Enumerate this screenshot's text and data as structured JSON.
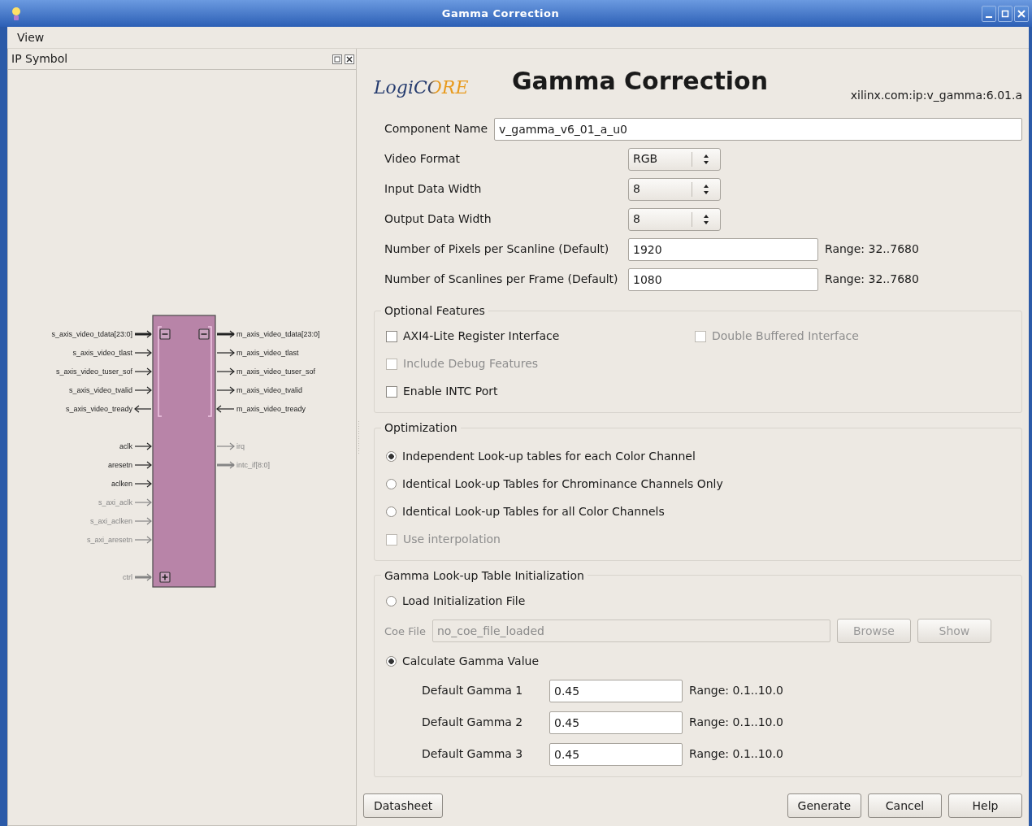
{
  "window": {
    "title": "Gamma Correction"
  },
  "menu": [
    {
      "label": "View"
    }
  ],
  "ip_panel": {
    "title": "IP Symbol",
    "symbol": {
      "left_groups": [
        [
          {
            "name": "s_axis_video_tdata[23:0]",
            "output": false,
            "bus": true,
            "disabled": false,
            "expanded": true
          },
          {
            "name": "s_axis_video_tlast",
            "output": false,
            "bus": false,
            "disabled": false
          },
          {
            "name": "s_axis_video_tuser_sof",
            "output": false,
            "bus": false,
            "disabled": false
          },
          {
            "name": "s_axis_video_tvalid",
            "output": false,
            "bus": false,
            "disabled": false
          },
          {
            "name": "s_axis_video_tready",
            "output": true,
            "bus": false,
            "disabled": false
          }
        ],
        [
          {
            "name": "aclk",
            "output": false,
            "bus": false,
            "disabled": false
          },
          {
            "name": "aresetn",
            "output": false,
            "bus": false,
            "disabled": false
          },
          {
            "name": "aclken",
            "output": false,
            "bus": false,
            "disabled": false
          },
          {
            "name": "s_axi_aclk",
            "output": false,
            "bus": false,
            "disabled": true
          },
          {
            "name": "s_axi_aclken",
            "output": false,
            "bus": false,
            "disabled": true
          },
          {
            "name": "s_axi_aresetn",
            "output": false,
            "bus": false,
            "disabled": true
          }
        ],
        [
          {
            "name": "ctrl",
            "output": false,
            "bus": true,
            "disabled": true,
            "expanded": false
          }
        ]
      ],
      "right_groups": [
        [
          {
            "name": "m_axis_video_tdata[23:0]",
            "output": true,
            "bus": true,
            "disabled": false,
            "expanded": true
          },
          {
            "name": "m_axis_video_tlast",
            "output": true,
            "bus": false,
            "disabled": false
          },
          {
            "name": "m_axis_video_tuser_sof",
            "output": true,
            "bus": false,
            "disabled": false
          },
          {
            "name": "m_axis_video_tvalid",
            "output": true,
            "bus": false,
            "disabled": false
          },
          {
            "name": "m_axis_video_tready",
            "output": false,
            "bus": false,
            "disabled": false
          }
        ],
        [
          {
            "name": "irq",
            "output": true,
            "bus": false,
            "disabled": true
          },
          {
            "name": "intc_if[8:0]",
            "output": true,
            "bus": true,
            "disabled": true
          }
        ]
      ]
    }
  },
  "header": {
    "logo": "LogiCORE",
    "title": "Gamma Correction",
    "vlnv": "xilinx.com:ip:v_gamma:6.01.a"
  },
  "component_name": {
    "label": "Component Name",
    "value": "v_gamma_v6_01_a_u0"
  },
  "params": [
    {
      "kind": "select",
      "label": "Video Format",
      "value": "RGB"
    },
    {
      "kind": "select",
      "label": "Input Data Width",
      "value": "8"
    },
    {
      "kind": "select",
      "label": "Output Data Width",
      "value": "8"
    },
    {
      "kind": "text",
      "label": "Number of Pixels per Scanline (Default)",
      "value": "1920",
      "range": "Range: 32..7680"
    },
    {
      "kind": "text",
      "label": "Number of Scanlines per Frame (Default)",
      "value": "1080",
      "range": "Range: 32..7680"
    }
  ],
  "optional_features": {
    "title": "Optional Features",
    "rows": [
      [
        {
          "label": "AXI4-Lite Register Interface",
          "checked": false,
          "disabled": false
        },
        {
          "label": "Double Buffered Interface",
          "checked": false,
          "disabled": true
        }
      ],
      [
        {
          "label": "Include Debug Features",
          "checked": false,
          "disabled": true
        }
      ],
      [
        {
          "label": "Enable INTC Port",
          "checked": false,
          "disabled": false
        }
      ]
    ]
  },
  "optimization": {
    "title": "Optimization",
    "options": [
      {
        "kind": "radio",
        "label": "Independent Look-up tables for each Color Channel",
        "selected": true,
        "disabled": false
      },
      {
        "kind": "radio",
        "label": "Identical Look-up Tables for Chrominance Channels Only",
        "selected": false,
        "disabled": false
      },
      {
        "kind": "radio",
        "label": "Identical Look-up Tables for all Color Channels",
        "selected": false,
        "disabled": false
      },
      {
        "kind": "checkbox",
        "label": "Use interpolation",
        "checked": false,
        "disabled": true
      }
    ]
  },
  "gamma_init": {
    "title": "Gamma Look-up Table Initialization",
    "load": {
      "label": "Load Initialization File",
      "selected": false
    },
    "coe": {
      "label": "Coe File",
      "value": "no_coe_file_loaded",
      "disabled": true,
      "buttons": [
        {
          "label": "Browse",
          "disabled": true
        },
        {
          "label": "Show",
          "disabled": true
        }
      ]
    },
    "calculate": {
      "label": "Calculate Gamma Value",
      "selected": true
    },
    "gammas": [
      {
        "label": "Default Gamma 1",
        "value": "0.45",
        "range": "Range: 0.1..10.0"
      },
      {
        "label": "Default Gamma 2",
        "value": "0.45",
        "range": "Range: 0.1..10.0"
      },
      {
        "label": "Default Gamma 3",
        "value": "0.45",
        "range": "Range: 0.1..10.0"
      }
    ]
  },
  "footer": {
    "left": [
      {
        "label": "Datasheet"
      }
    ],
    "right": [
      {
        "label": "Generate"
      },
      {
        "label": "Cancel"
      },
      {
        "label": "Help"
      }
    ]
  }
}
